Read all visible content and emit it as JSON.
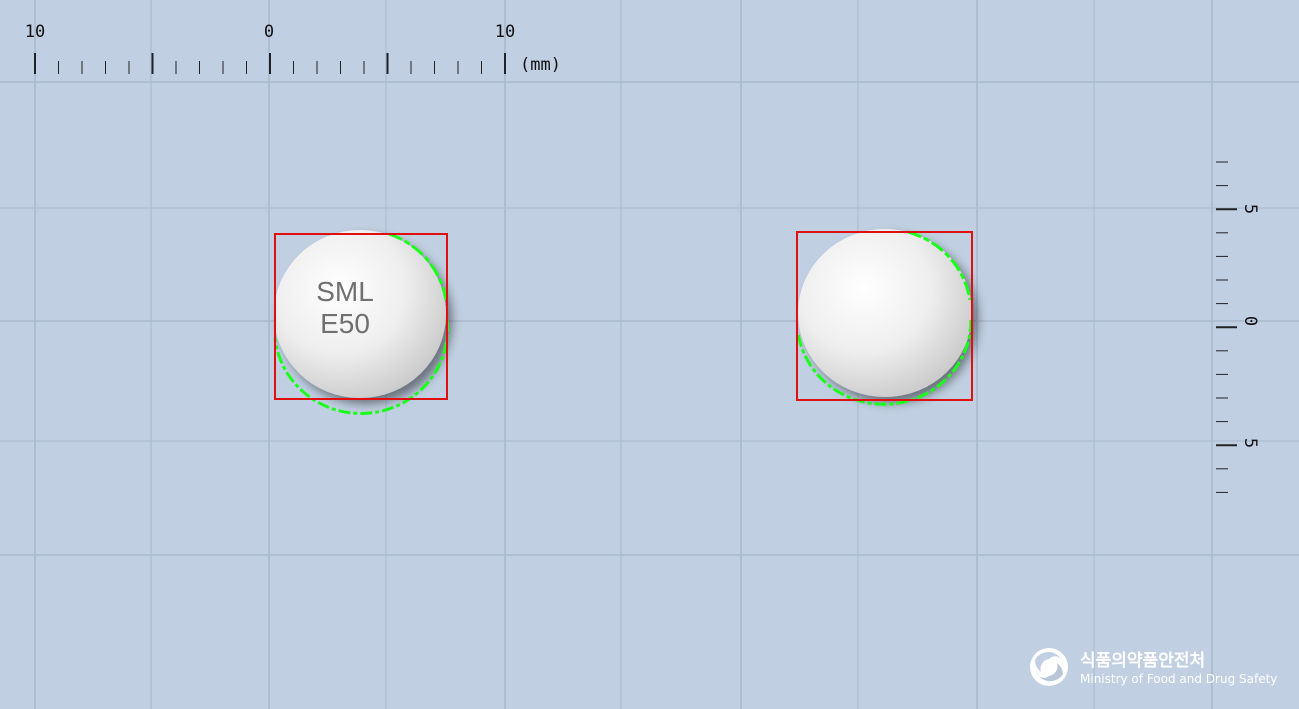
{
  "ruler_top": {
    "labels": [
      "10",
      "0",
      "10"
    ],
    "unit": "(mm)"
  },
  "ruler_right": {
    "labels": [
      "5",
      "0",
      "5"
    ]
  },
  "pills": [
    {
      "name": "pill-front",
      "imprint_line1": "SML",
      "imprint_line2": "E50"
    },
    {
      "name": "pill-back",
      "imprint_line1": "",
      "imprint_line2": ""
    }
  ],
  "logo": {
    "korean": "식품의약품안전처",
    "english": "Ministry of Food and Drug Safety"
  },
  "colors": {
    "background": "#c0cfe1",
    "grid": "#a9bacd",
    "bounding_box": "#e01010",
    "contour": "#19ff19",
    "pill": "#ececec"
  }
}
